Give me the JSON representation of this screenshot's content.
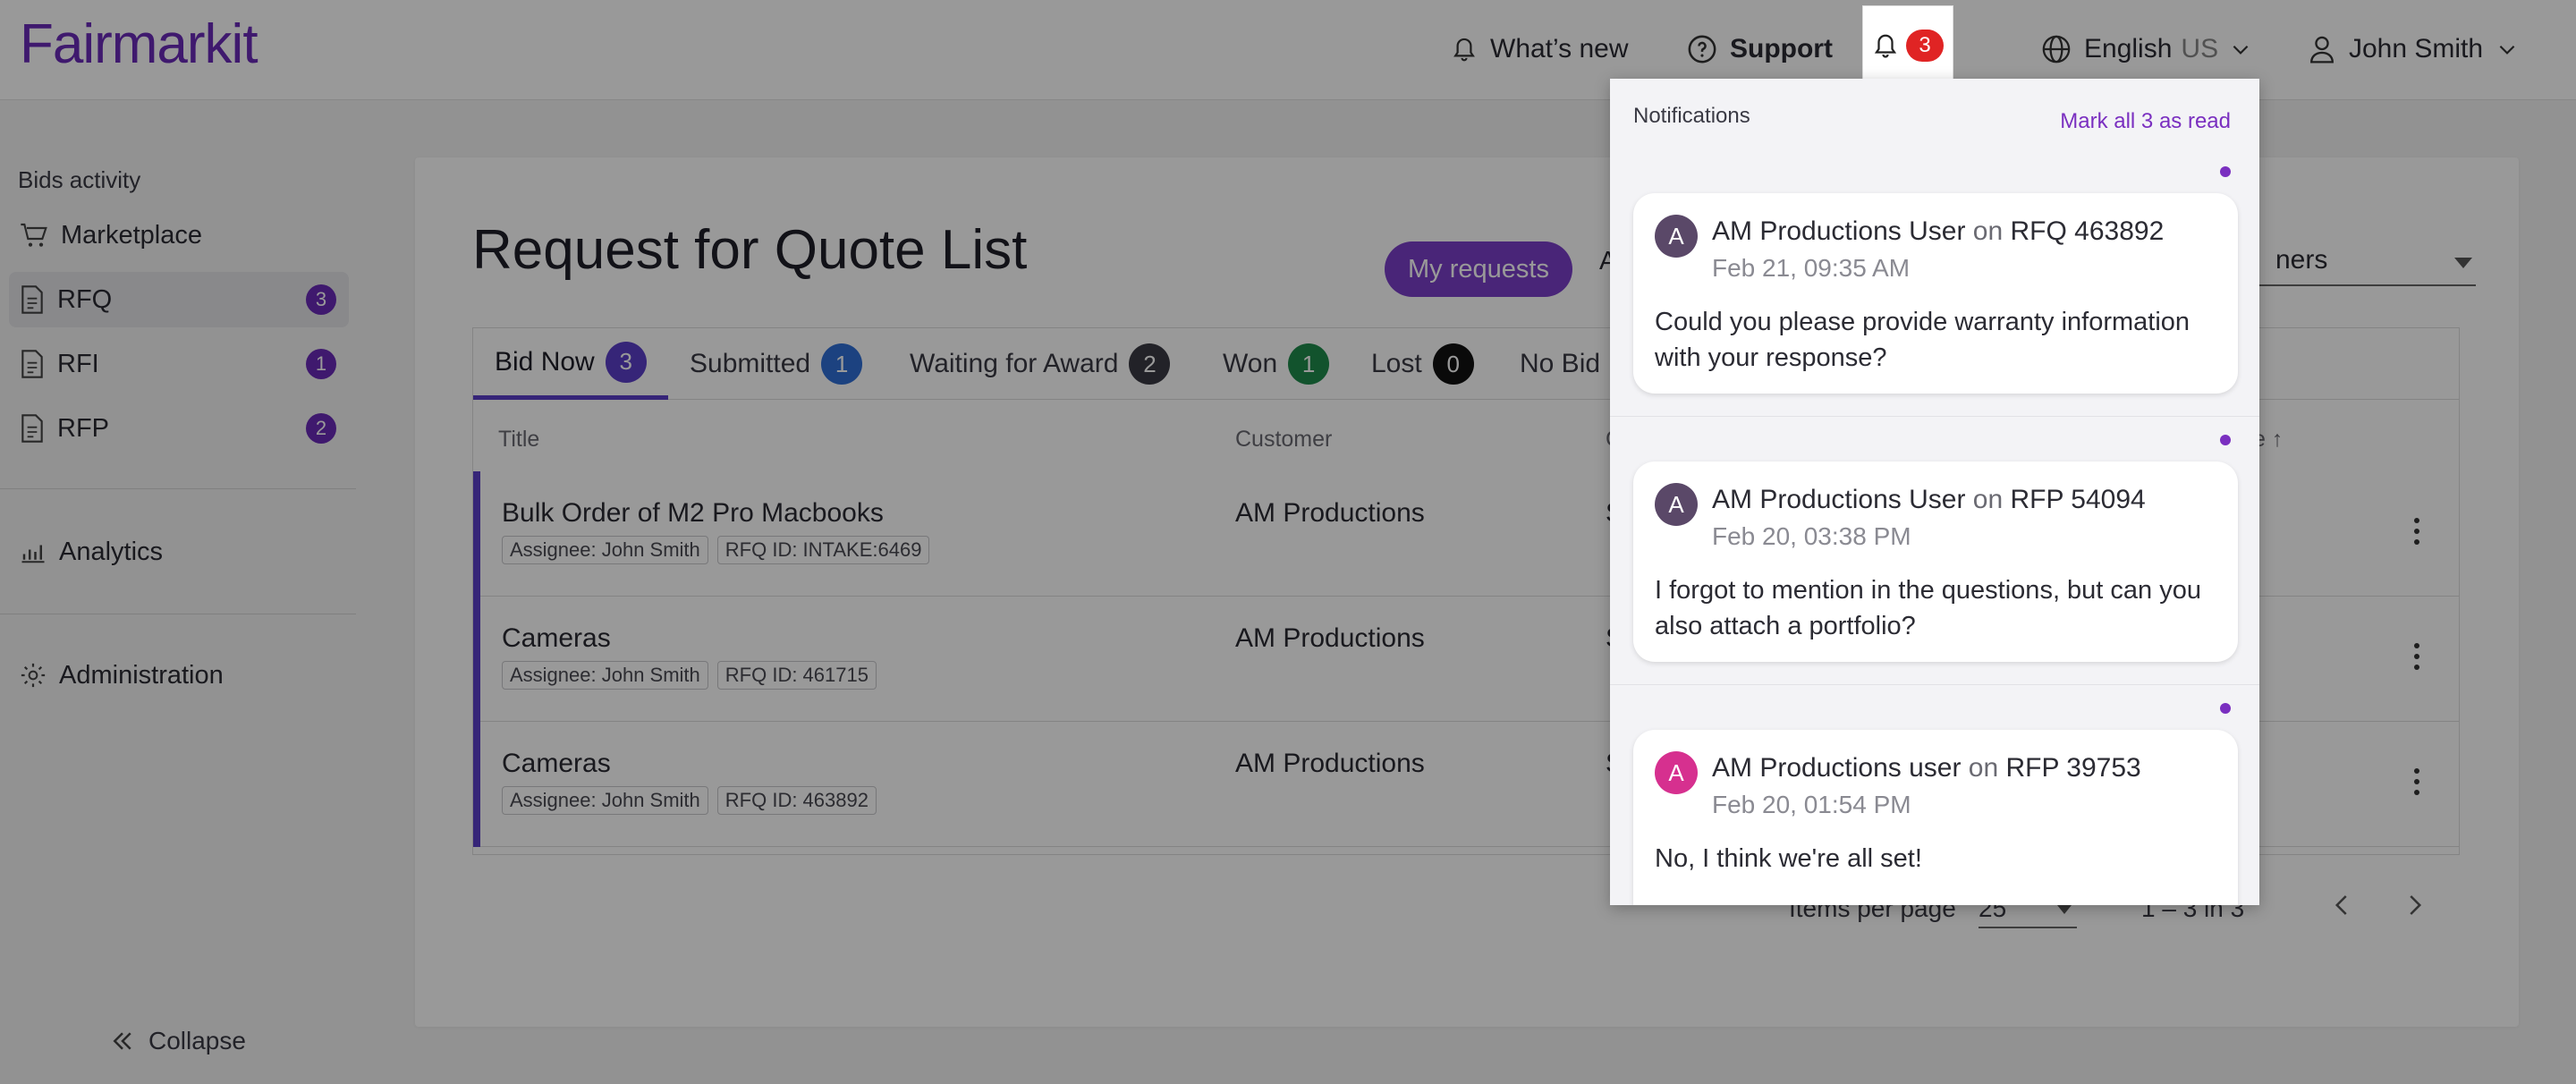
{
  "header": {
    "logo": "Fairmarkit",
    "whats_new": "What’s new",
    "support": "Support",
    "notif_count": "3",
    "language": "English",
    "language_region": "US",
    "user": "John Smith"
  },
  "sidebar": {
    "section_label": "Bids activity",
    "items": [
      {
        "label": "Marketplace",
        "badge": ""
      },
      {
        "label": "RFQ",
        "badge": "3"
      },
      {
        "label": "RFI",
        "badge": "1"
      },
      {
        "label": "RFP",
        "badge": "2"
      }
    ],
    "analytics": "Analytics",
    "administration": "Administration",
    "collapse": "Collapse"
  },
  "main": {
    "title": "Request for Quote List",
    "my_requests": "My requests",
    "all_partial": "A",
    "select_partial": "ners",
    "tabs": [
      {
        "label": "Bid Now",
        "count": "3",
        "color": "#5b3fc8"
      },
      {
        "label": "Submitted",
        "count": "1",
        "color": "#2f6fd6"
      },
      {
        "label": "Waiting for Award",
        "count": "2",
        "color": "#3a3a44"
      },
      {
        "label": "Won",
        "count": "1",
        "color": "#1f8a4c"
      },
      {
        "label": "Lost",
        "count": "0",
        "color": "#111111"
      },
      {
        "label": "No Bid",
        "count": "",
        "color": "#e8a317"
      }
    ],
    "columns": [
      "Title",
      "Customer",
      "C",
      "e ↑"
    ],
    "rows": [
      {
        "title": "Bulk Order of M2 Pro Macbooks",
        "assignee": "Assignee: John Smith",
        "rfq_id": "RFQ ID: INTAKE:6469",
        "customer": "AM Productions",
        "col3": "S"
      },
      {
        "title": "Cameras",
        "assignee": "Assignee: John Smith",
        "rfq_id": "RFQ ID: 461715",
        "customer": "AM Productions",
        "col3": "S"
      },
      {
        "title": "Cameras",
        "assignee": "Assignee: John Smith",
        "rfq_id": "RFQ ID: 463892",
        "customer": "AM Productions",
        "col3": "S"
      }
    ],
    "pager": {
      "items_per_page_label": "Items per page",
      "items_per_page": "25",
      "range": "1 – 3 in 3"
    }
  },
  "notifications": {
    "title": "Notifications",
    "mark_all": "Mark all 3 as read",
    "items": [
      {
        "avatar": "A",
        "avatar_color": "#5a4868",
        "user": "AM Productions User",
        "on": "on",
        "target": "RFQ 463892",
        "date": "Feb 21, 09:35 AM",
        "message": "Could you please provide warranty information with your response?"
      },
      {
        "avatar": "A",
        "avatar_color": "#5a4868",
        "user": "AM Productions User",
        "on": "on",
        "target": "RFP 54094",
        "date": "Feb 20, 03:38 PM",
        "message": "I forgot to mention in the questions, but can you also attach a portfolio?"
      },
      {
        "avatar": "A",
        "avatar_color": "#d6308f",
        "user": "AM Productions user",
        "on": "on",
        "target": "RFP 39753",
        "date": "Feb 20, 01:54 PM",
        "message": "No, I think we're all set!"
      }
    ]
  }
}
